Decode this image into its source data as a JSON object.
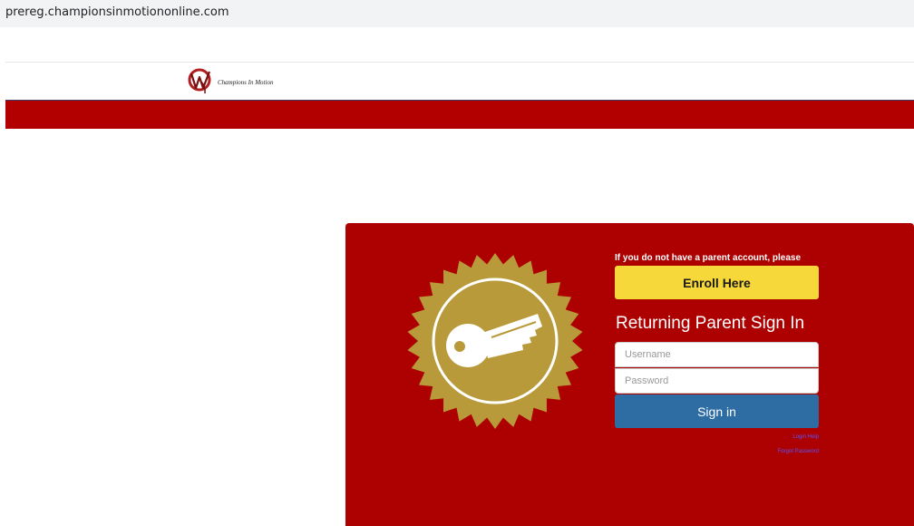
{
  "browser": {
    "url": "prereg.championsinmotiononline.com"
  },
  "header": {
    "logo_text": "Champions In Motion"
  },
  "login_panel": {
    "prompt": "If you do not have a parent account, please",
    "enroll_label": "Enroll Here",
    "heading": "Returning Parent Sign In",
    "username_placeholder": "Username",
    "password_placeholder": "Password",
    "signin_label": "Sign in",
    "login_help": "Login Help",
    "forgot_password": "Forgot Password"
  },
  "colors": {
    "brand_red": "#ad0000",
    "enroll_yellow": "#f6d83a",
    "signin_blue": "#2d6da3",
    "badge_gold": "#b89a3a"
  },
  "icons": {
    "badge": "key-seal-icon",
    "logo": "champions-in-motion-logo"
  }
}
